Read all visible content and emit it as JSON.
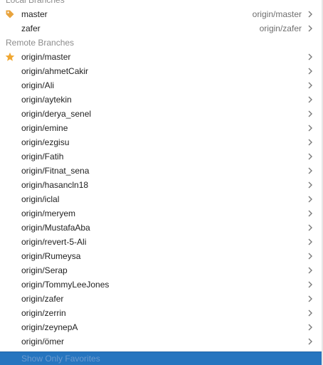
{
  "local_branches": {
    "header": "Local Branches",
    "items": [
      {
        "name": "master",
        "tracking": "origin/master",
        "icon": "tag-icon"
      },
      {
        "name": "zafer",
        "tracking": "origin/zafer",
        "icon": ""
      }
    ]
  },
  "remote_branches": {
    "header": "Remote Branches",
    "items": [
      {
        "name": "origin/master",
        "icon": "star-icon"
      },
      {
        "name": "origin/ahmetCakir"
      },
      {
        "name": "origin/Ali"
      },
      {
        "name": "origin/aytekin"
      },
      {
        "name": "origin/derya_senel"
      },
      {
        "name": "origin/emine"
      },
      {
        "name": "origin/ezgisu"
      },
      {
        "name": "origin/Fatih"
      },
      {
        "name": "origin/Fitnat_sena"
      },
      {
        "name": "origin/hasancln18"
      },
      {
        "name": "origin/iclal"
      },
      {
        "name": "origin/meryem"
      },
      {
        "name": "origin/MustafaAba"
      },
      {
        "name": "origin/revert-5-Ali"
      },
      {
        "name": "origin/Rumeysa"
      },
      {
        "name": "origin/Serap"
      },
      {
        "name": "origin/TommyLeeJones"
      },
      {
        "name": "origin/zafer"
      },
      {
        "name": "origin/zerrin"
      },
      {
        "name": "origin/zeynepA"
      },
      {
        "name": "origin/ömer"
      }
    ]
  },
  "footer": {
    "label": "Show Only Favorites"
  },
  "colors": {
    "tag": "#e8a33d",
    "star": "#f0a732",
    "chevron": "#7a7a7a",
    "selection": "#2675bf"
  }
}
